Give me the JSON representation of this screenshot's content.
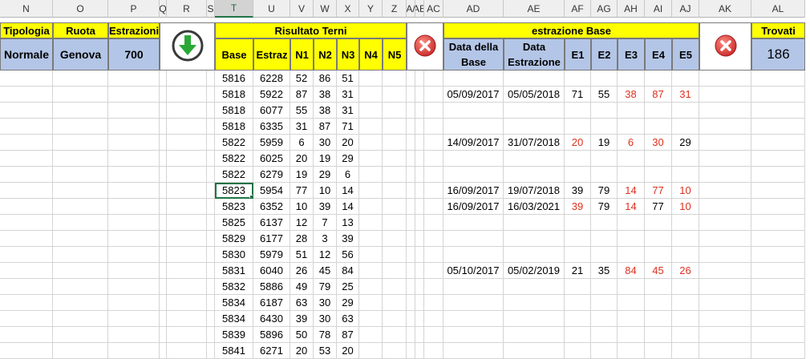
{
  "columns": [
    {
      "letter": "N",
      "selected": false
    },
    {
      "letter": "O",
      "selected": false
    },
    {
      "letter": "P",
      "selected": false
    },
    {
      "letter": "Q",
      "selected": false
    },
    {
      "letter": "R",
      "selected": false
    },
    {
      "letter": "S",
      "selected": false
    },
    {
      "letter": "T",
      "selected": true
    },
    {
      "letter": "U",
      "selected": false
    },
    {
      "letter": "V",
      "selected": false
    },
    {
      "letter": "W",
      "selected": false
    },
    {
      "letter": "X",
      "selected": false
    },
    {
      "letter": "Y",
      "selected": false
    },
    {
      "letter": "Z",
      "selected": false
    },
    {
      "letter": "AA",
      "selected": false
    },
    {
      "letter": "AB",
      "selected": false
    },
    {
      "letter": "AC",
      "selected": false
    },
    {
      "letter": "AD",
      "selected": false
    },
    {
      "letter": "AE",
      "selected": false
    },
    {
      "letter": "AF",
      "selected": false
    },
    {
      "letter": "AG",
      "selected": false
    },
    {
      "letter": "AH",
      "selected": false
    },
    {
      "letter": "AI",
      "selected": false
    },
    {
      "letter": "AJ",
      "selected": false
    },
    {
      "letter": "AK",
      "selected": false
    },
    {
      "letter": "AL",
      "selected": false
    }
  ],
  "column_header_texts": {
    "N": "N",
    "O": "O",
    "P": "P",
    "Q": "Q",
    "R": "R",
    "S": "S",
    "T": "T",
    "U": "U",
    "V": "V",
    "W": "W",
    "X": "X",
    "Y": "Y",
    "Z": "Z",
    "AA": "A/",
    "AB": "AE",
    "AC": "AC",
    "AD": "AD",
    "AE": "AE",
    "AF": "AF",
    "AG": "AG",
    "AH": "AH",
    "AI": "AI",
    "AJ": "AJ",
    "AK": "AK",
    "AL": "AL"
  },
  "header": {
    "tipologia_label": "Tipologia",
    "ruota_label": "Ruota",
    "estrazioni_label": "Estrazioni",
    "tipologia_value": "Normale",
    "ruota_value": "Genova",
    "estrazioni_value": "700",
    "risultato_title": "Risultato Terni",
    "risultato_cols": [
      "Base",
      "Estraz",
      "N1",
      "N2",
      "N3",
      "N4",
      "N5"
    ],
    "estrazione_title": "estrazione Base",
    "estrazione_cols": [
      "Data della Base",
      "Data Estrazione",
      "E1",
      "E2",
      "E3",
      "E4",
      "E5"
    ],
    "trovati_label": "Trovati",
    "trovati_value": "186"
  },
  "icons": {
    "download": "green-down-arrow-icon",
    "clear_left": "red-x-icon",
    "clear_right": "red-x-icon"
  },
  "colors": {
    "yellow": "#ffff00",
    "blue": "#b4c6e7",
    "red": "#e0301e",
    "excel_green": "#217346"
  },
  "active_cell": {
    "row": 7,
    "col": "T"
  },
  "rows": [
    {
      "base": "5816",
      "estraz": "6228",
      "n": [
        "52",
        "86",
        "51"
      ]
    },
    {
      "base": "5818",
      "estraz": "5922",
      "n": [
        "87",
        "38",
        "31"
      ],
      "d1": "05/09/2017",
      "d2": "05/05/2018",
      "e": [
        "71",
        "55",
        "38",
        "87",
        "31"
      ],
      "red": [
        false,
        false,
        true,
        true,
        true
      ]
    },
    {
      "base": "5818",
      "estraz": "6077",
      "n": [
        "55",
        "38",
        "31"
      ]
    },
    {
      "base": "5818",
      "estraz": "6335",
      "n": [
        "31",
        "87",
        "71"
      ]
    },
    {
      "base": "5822",
      "estraz": "5959",
      "n": [
        "6",
        "30",
        "20"
      ],
      "d1": "14/09/2017",
      "d2": "31/07/2018",
      "e": [
        "20",
        "19",
        "6",
        "30",
        "29"
      ],
      "red": [
        true,
        false,
        true,
        true,
        false
      ]
    },
    {
      "base": "5822",
      "estraz": "6025",
      "n": [
        "20",
        "19",
        "29"
      ]
    },
    {
      "base": "5822",
      "estraz": "6279",
      "n": [
        "19",
        "29",
        "6"
      ]
    },
    {
      "base": "5823",
      "estraz": "5954",
      "n": [
        "77",
        "10",
        "14"
      ],
      "d1": "16/09/2017",
      "d2": "19/07/2018",
      "e": [
        "39",
        "79",
        "14",
        "77",
        "10"
      ],
      "red": [
        false,
        false,
        true,
        true,
        true
      ]
    },
    {
      "base": "5823",
      "estraz": "6352",
      "n": [
        "10",
        "39",
        "14"
      ],
      "d1": "16/09/2017",
      "d2": "16/03/2021",
      "e": [
        "39",
        "79",
        "14",
        "77",
        "10"
      ],
      "red": [
        true,
        false,
        true,
        false,
        true
      ]
    },
    {
      "base": "5825",
      "estraz": "6137",
      "n": [
        "12",
        "7",
        "13"
      ]
    },
    {
      "base": "5829",
      "estraz": "6177",
      "n": [
        "28",
        "3",
        "39"
      ]
    },
    {
      "base": "5830",
      "estraz": "5979",
      "n": [
        "51",
        "12",
        "56"
      ]
    },
    {
      "base": "5831",
      "estraz": "6040",
      "n": [
        "26",
        "45",
        "84"
      ],
      "d1": "05/10/2017",
      "d2": "05/02/2019",
      "e": [
        "21",
        "35",
        "84",
        "45",
        "26"
      ],
      "red": [
        false,
        false,
        true,
        true,
        true
      ]
    },
    {
      "base": "5832",
      "estraz": "5886",
      "n": [
        "49",
        "79",
        "25"
      ]
    },
    {
      "base": "5834",
      "estraz": "6187",
      "n": [
        "63",
        "30",
        "29"
      ]
    },
    {
      "base": "5834",
      "estraz": "6430",
      "n": [
        "39",
        "30",
        "63"
      ]
    },
    {
      "base": "5839",
      "estraz": "5896",
      "n": [
        "50",
        "78",
        "87"
      ]
    },
    {
      "base": "5841",
      "estraz": "6271",
      "n": [
        "20",
        "53",
        "20"
      ]
    }
  ]
}
